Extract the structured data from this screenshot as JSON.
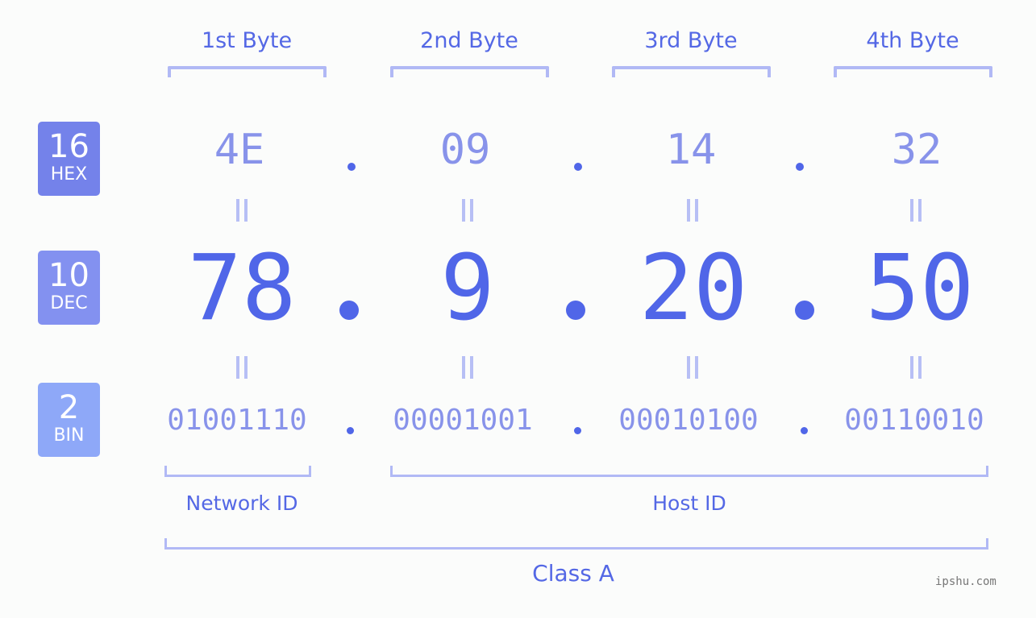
{
  "colors": {
    "hex_badge": "#7482ea",
    "dec_badge": "#8391f0",
    "bin_badge": "#8ea8f8",
    "primary_text": "#5066e8",
    "secondary_text": "#8893ea",
    "bracket": "#b1b9f5"
  },
  "badges": [
    {
      "number": "16",
      "label": "HEX"
    },
    {
      "number": "10",
      "label": "DEC"
    },
    {
      "number": "2",
      "label": "BIN"
    }
  ],
  "bytes": [
    {
      "label": "1st Byte",
      "hex": "4E",
      "dec": "78",
      "bin": "01001110"
    },
    {
      "label": "2nd Byte",
      "hex": "09",
      "dec": "9",
      "bin": "00001001"
    },
    {
      "label": "3rd Byte",
      "hex": "14",
      "dec": "20",
      "bin": "00010100"
    },
    {
      "label": "4th Byte",
      "hex": "32",
      "dec": "50",
      "bin": "00110010"
    }
  ],
  "separator": ".",
  "sections": {
    "network_id": "Network ID",
    "host_id": "Host ID",
    "class": "Class A"
  },
  "watermark": "ipshu.com"
}
